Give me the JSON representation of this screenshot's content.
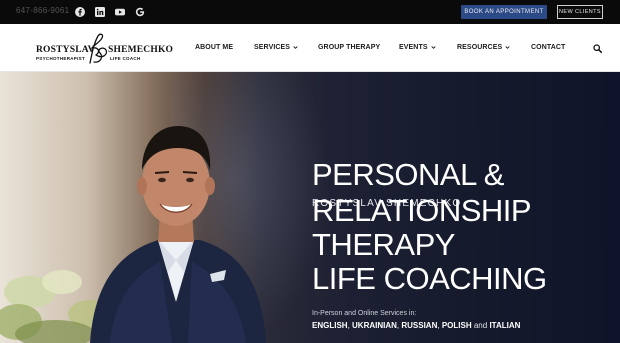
{
  "topbar": {
    "phone": "647-866-9061",
    "social_icons": [
      "facebook-icon",
      "linkedin-icon",
      "youtube-icon",
      "google-icon"
    ],
    "book_label": "BOOK AN APPOINTMENT",
    "new_clients_label": "NEW CLIENTS"
  },
  "logo": {
    "first_name": "ROSTYSLAV",
    "last_name": "SHEMECHKO",
    "subtitle_left": "PSYCHOTHERAPIST",
    "subtitle_right": "LIFE COACH"
  },
  "nav": {
    "items": [
      {
        "label": "ABOUT ME",
        "dropdown": false
      },
      {
        "label": "SERVICES",
        "dropdown": true
      },
      {
        "label": "GROUP THERAPY",
        "dropdown": false
      },
      {
        "label": "EVENTS",
        "dropdown": true
      },
      {
        "label": "RESOURCES",
        "dropdown": true
      },
      {
        "label": "CONTACT",
        "dropdown": false
      }
    ],
    "search_icon": "search-icon"
  },
  "hero": {
    "name": "ROSTYSLAV SHEMECHKO",
    "headline_lines": [
      "PERSONAL &",
      "RELATIONSHIP",
      "THERAPY",
      "LIFE COACHING"
    ],
    "services_intro": "In-Person and Online Services in:",
    "languages": [
      "ENGLISH",
      "UKRAINIAN",
      "RUSSIAN",
      "POLISH",
      "ITALIAN"
    ],
    "languages_conjunction": "and"
  },
  "colors": {
    "topbar_bg": "#0a0a0a",
    "book_button_bg": "#2c4a86",
    "hero_dark": "#151a2c",
    "text_dark": "#1a1a1a"
  }
}
